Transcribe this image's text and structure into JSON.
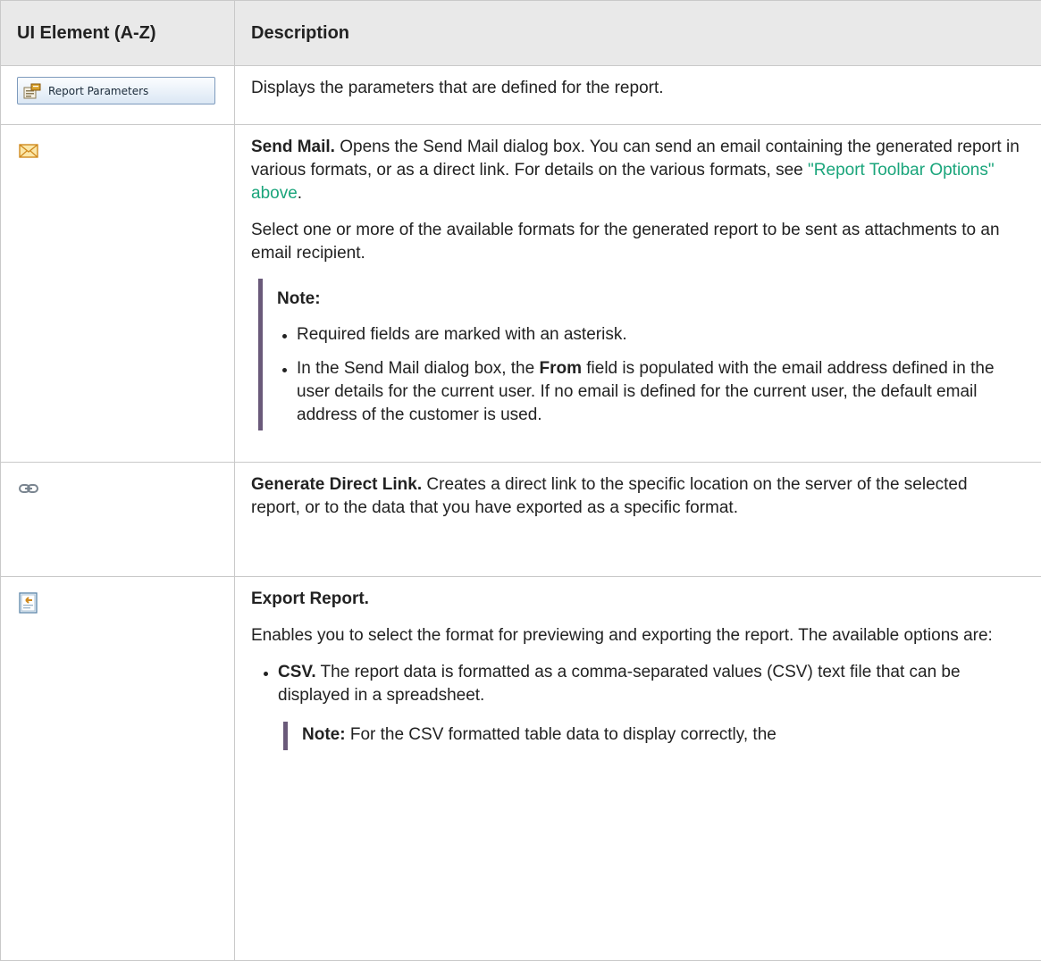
{
  "header": {
    "col1": "UI Element (A-Z)",
    "col2": "Description"
  },
  "colors": {
    "link": "#1aa57b",
    "note_bar": "#6a5a7a",
    "header_bg": "#e9e9e9"
  },
  "rows": {
    "report_parameters": {
      "button_label": "Report Parameters",
      "icon": "report-parameters-icon",
      "description": "Displays the parameters that are defined for the report."
    },
    "send_mail": {
      "icon": "envelope-icon",
      "title": "Send Mail.",
      "text1": " Opens the Send Mail dialog box. You can send an email containing the generated report in various formats, or as a direct link. For details on the various formats, see ",
      "link": "\"Report Toolbar Options\" above",
      "text1_end": ".",
      "text2": "Select one or more of the available formats for the generated report to be sent as attachments to an email recipient.",
      "note_title": "Note:",
      "note_item1": "Required fields are marked with an asterisk.",
      "note_item2_a": "In the Send Mail dialog box, the ",
      "note_item2_bold": "From",
      "note_item2_b": " field is populated with the email address defined in the user details for the current user. If no email is defined for the current user, the default email address of the customer is used."
    },
    "direct_link": {
      "icon": "chain-link-icon",
      "title": "Generate Direct Link.",
      "text": " Creates a direct link to the specific location on the server of the selected report, or to the data that you have exported as a specific format."
    },
    "export_report": {
      "icon": "export-report-icon",
      "title": "Export Report.",
      "text": "Enables you to select the format for previewing and exporting the report. The available options are:",
      "csv_title": "CSV.",
      "csv_text": " The report data is formatted as a comma-separated values (CSV) text file that can be displayed in a spreadsheet.",
      "csv_note_title": "Note:",
      "csv_note_text": "  For the CSV formatted table data to display correctly, the"
    }
  }
}
